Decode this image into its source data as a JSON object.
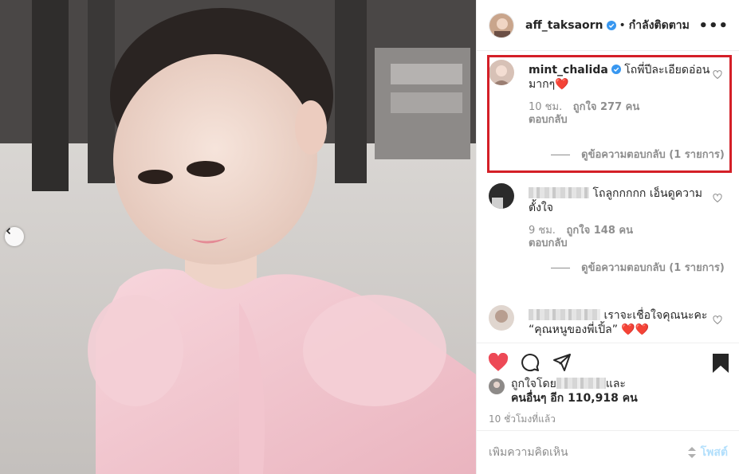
{
  "header": {
    "username": "aff_taksaorn",
    "separator": "•",
    "follow_status": "กำลังติดตาม",
    "more_icon": "more-options-icon"
  },
  "comments": [
    {
      "username": "mint_chalida",
      "verified": true,
      "text": "โถพี่ปีละเอียดอ่อนมากๆ❤️",
      "time": "10 ชม.",
      "likes": "ถูกใจ 277 คน",
      "reply": "ตอบกลับ",
      "view_replies": "ดูข้อความตอบกลับ (1 รายการ)",
      "highlighted": true
    },
    {
      "username": "",
      "text": "โถลูกกกกก เอ็นดูความตั้งใจ",
      "time": "9 ชม.",
      "likes": "ถูกใจ 148 คน",
      "reply": "ตอบกลับ",
      "view_replies": "ดูข้อความตอบกลับ (1 รายการ)",
      "highlighted": false
    },
    {
      "username": "",
      "text": "เราจะเชื่อใจคุณนะคะ “คุณหนูของพี่เปิ้ล” ❤️❤️",
      "highlighted": false
    }
  ],
  "actions": {
    "like_icon": "heart-filled-icon",
    "comment_icon": "comment-icon",
    "share_icon": "share-icon",
    "save_icon": "bookmark-icon",
    "liked_by_prefix": "ถูกใจโดย",
    "liked_by_suffix": "และ",
    "others": "คนอื่นๆ อีก 110,918 คน",
    "posted_ago": "10 ชั่วโมงที่แล้ว"
  },
  "add_comment": {
    "placeholder": "เพิ่มความคิดเห็น",
    "post_label": "โพสต์"
  },
  "colors": {
    "like_red": "#ed4956",
    "highlight_red": "#d41f27",
    "verified_blue": "#3897f0",
    "post_disabled": "#b2dffc"
  }
}
